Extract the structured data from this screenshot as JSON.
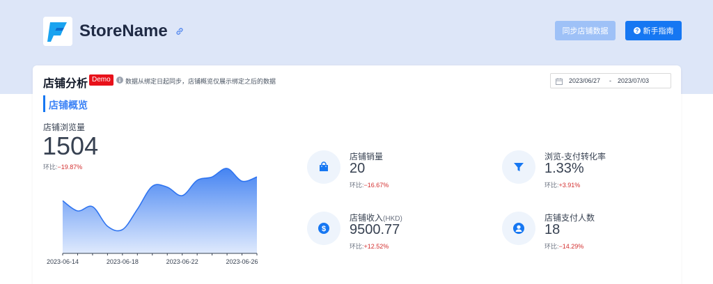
{
  "header": {
    "store_name": "StoreName",
    "sync_button": "同步店铺数据",
    "guide_button": "新手指南"
  },
  "card": {
    "title": "店铺分析",
    "badge": "Demo",
    "info_text": "数据从绑定日起同步，店铺概览仅展示绑定之后的数据",
    "date_range": {
      "start": "2023/06/27",
      "separator": "-",
      "end": "2023/07/03"
    },
    "section_title": "店铺概览"
  },
  "views": {
    "label": "店铺浏览量",
    "value": "1504",
    "ratio_label": "环比:",
    "ratio_value": "−19.87%"
  },
  "metrics": {
    "sales": {
      "label": "店铺销量",
      "value": "20",
      "ratio_label": "环比:",
      "ratio_value": "−16.67%",
      "icon": "shopping-bag-icon"
    },
    "conversion": {
      "label": "浏览-支付转化率",
      "value": "1.33%",
      "ratio_label": "环比:",
      "ratio_value": "+3.91%",
      "icon": "funnel-icon"
    },
    "revenue": {
      "label": "店铺收入",
      "unit": "(HKD)",
      "value": "9500.77",
      "ratio_label": "环比:",
      "ratio_value": "+12.52%",
      "icon": "dollar-icon"
    },
    "payers": {
      "label": "店铺支付人数",
      "value": "18",
      "ratio_label": "环比:",
      "ratio_value": "−14.29%",
      "icon": "user-icon"
    }
  },
  "chart_data": {
    "type": "area",
    "x_tick_labels": [
      "2023-06-14",
      "2023-06-18",
      "2023-06-22",
      "2023-06-26"
    ],
    "x_ticks_index": [
      0,
      4,
      8,
      12
    ],
    "values": [
      0.62,
      0.5,
      0.55,
      0.32,
      0.28,
      0.52,
      0.79,
      0.78,
      0.68,
      0.86,
      0.9,
      1.0,
      0.85,
      0.9
    ],
    "values_note_scale": "relative heights 0-1",
    "color": "#2f74f0",
    "grid": false
  },
  "colors": {
    "accent": "#1677f2",
    "negative": "#d32f2f",
    "band": "#dde6f8"
  }
}
